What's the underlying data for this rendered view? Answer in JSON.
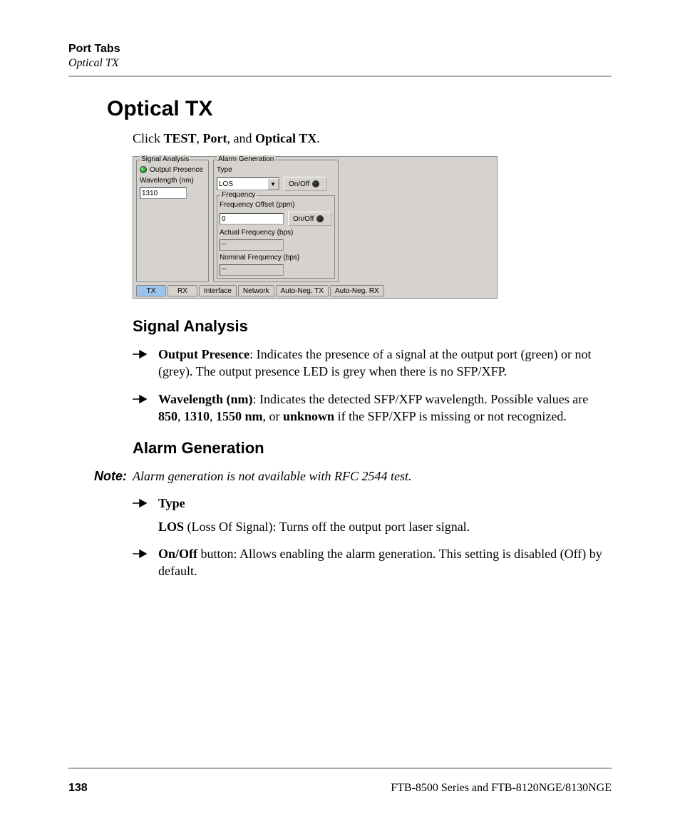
{
  "header": {
    "chapter": "Port Tabs",
    "section": "Optical TX"
  },
  "title": "Optical TX",
  "intro": {
    "prefix": "Click ",
    "b1": "TEST",
    "sep1": ", ",
    "b2": "Port",
    "sep2": ", and ",
    "b3": "Optical TX",
    "suffix": "."
  },
  "screenshot": {
    "signal_analysis": {
      "legend": "Signal Analysis",
      "output_presence": "Output Presence",
      "wavelength_label": "Wavelength (nm)",
      "wavelength_value": "1310"
    },
    "alarm_generation": {
      "legend": "Alarm Generation",
      "type_label": "Type",
      "type_value": "LOS",
      "onoff": "On/Off",
      "frequency_legend": "Frequency",
      "freq_offset_label": "Frequency Offset (ppm)",
      "freq_offset_value": "0",
      "actual_freq_label": "Actual Frequency (bps)",
      "actual_freq_value": "--",
      "nominal_freq_label": "Nominal Frequency (bps)",
      "nominal_freq_value": "--"
    },
    "tabs": [
      "TX",
      "RX",
      "Interface",
      "Network",
      "Auto-Neg. TX",
      "Auto-Neg. RX"
    ]
  },
  "sig_heading": "Signal Analysis",
  "sig_b1_bold": "Output Presence",
  "sig_b1_text": ": Indicates the presence of a signal at the output port (green) or not (grey). The output presence LED is grey when there is no SFP/XFP.",
  "sig_b2_bold": "Wavelength (nm)",
  "sig_b2_pre": ": Indicates the detected SFP/XFP wavelength. Possible values are ",
  "sig_b2_v1": "850",
  "sig_b2_s1": ", ",
  "sig_b2_v2": "1310",
  "sig_b2_s2": ", ",
  "sig_b2_v3": "1550 nm",
  "sig_b2_s3": ", or ",
  "sig_b2_v4": "unknown",
  "sig_b2_post": " if the SFP/XFP is missing or not recognized.",
  "alarm_heading": "Alarm Generation",
  "note_label": "Note:",
  "note_text": "Alarm generation is not available with RFC 2544 test.",
  "alarm_b1_bold": "Type",
  "alarm_b1_sub_bold": "LOS",
  "alarm_b1_sub_text": " (Loss Of Signal): Turns off the output port laser signal.",
  "alarm_b2_bold": "On/Off",
  "alarm_b2_text": " button: Allows enabling the alarm generation. This setting is disabled (Off) by default.",
  "footer": {
    "page": "138",
    "product": "FTB-8500 Series and FTB-8120NGE/8130NGE"
  }
}
